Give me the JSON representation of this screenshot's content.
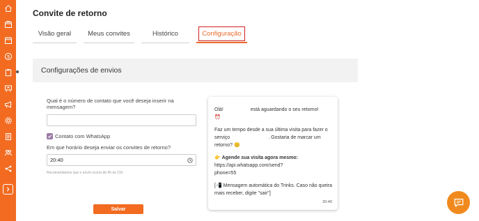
{
  "colors": {
    "sidebar": "#f26b21",
    "accent": "#e96b2c",
    "highlight_box": "#d21f1f",
    "checkbox": "#9a7aa6",
    "save_button": "#f26b21",
    "chat_fab": "#f08a1e"
  },
  "sidebar": {
    "icons": [
      "home-icon",
      "store-icon",
      "calendar-icon",
      "money-icon",
      "clipboard-icon",
      "chat-presentation-icon",
      "megaphone-icon",
      "settings-icon",
      "report-icon",
      "team-icon",
      "share-icon"
    ],
    "expand_icon": "chevron-right-icon"
  },
  "page": {
    "title": "Convite de retorno"
  },
  "tabs": [
    {
      "label": "Visão geral",
      "active": false
    },
    {
      "label": "Meus convites",
      "active": false
    },
    {
      "label": "Histórico",
      "active": false
    },
    {
      "label": "Configuração",
      "active": true
    }
  ],
  "panel": {
    "title": "Configurações de envios"
  },
  "form": {
    "contact_label": "Qual é o número de contato que você deseja inserir na mensagem?",
    "contact_value": "",
    "whatsapp_label": "Contato com WhatsApp",
    "whatsapp_checked": true,
    "time_label": "Em que horário deseja enviar os convites de retorno?",
    "time_value": "20:40",
    "hint": "Recomendamos que o envio ocorra de 9h às 21h",
    "save_label": "Salvar"
  },
  "preview": {
    "line1a": "Olá!",
    "line1b": "está aguardando o seu retorno!",
    "emoji1": "⏰",
    "line2": "Faz um tempo desde a sua última visita para fazer o",
    "line3a": "serviço",
    "line3b": ". Gostaria de marcar um",
    "line4": "retorno? 😊",
    "cta_emoji": "👉",
    "cta": "Agende sua visita agora mesmo:",
    "link1": "https://api.whatsapp.com/send?",
    "link2": "phone=55",
    "footer_emoji": "📲",
    "footer1": "Mensagem automática do Trinks. Caso não queira",
    "footer2": "mais receber, digite \"sair\"]",
    "time": "20:40"
  },
  "chat_fab": {
    "icon": "chat-icon"
  }
}
